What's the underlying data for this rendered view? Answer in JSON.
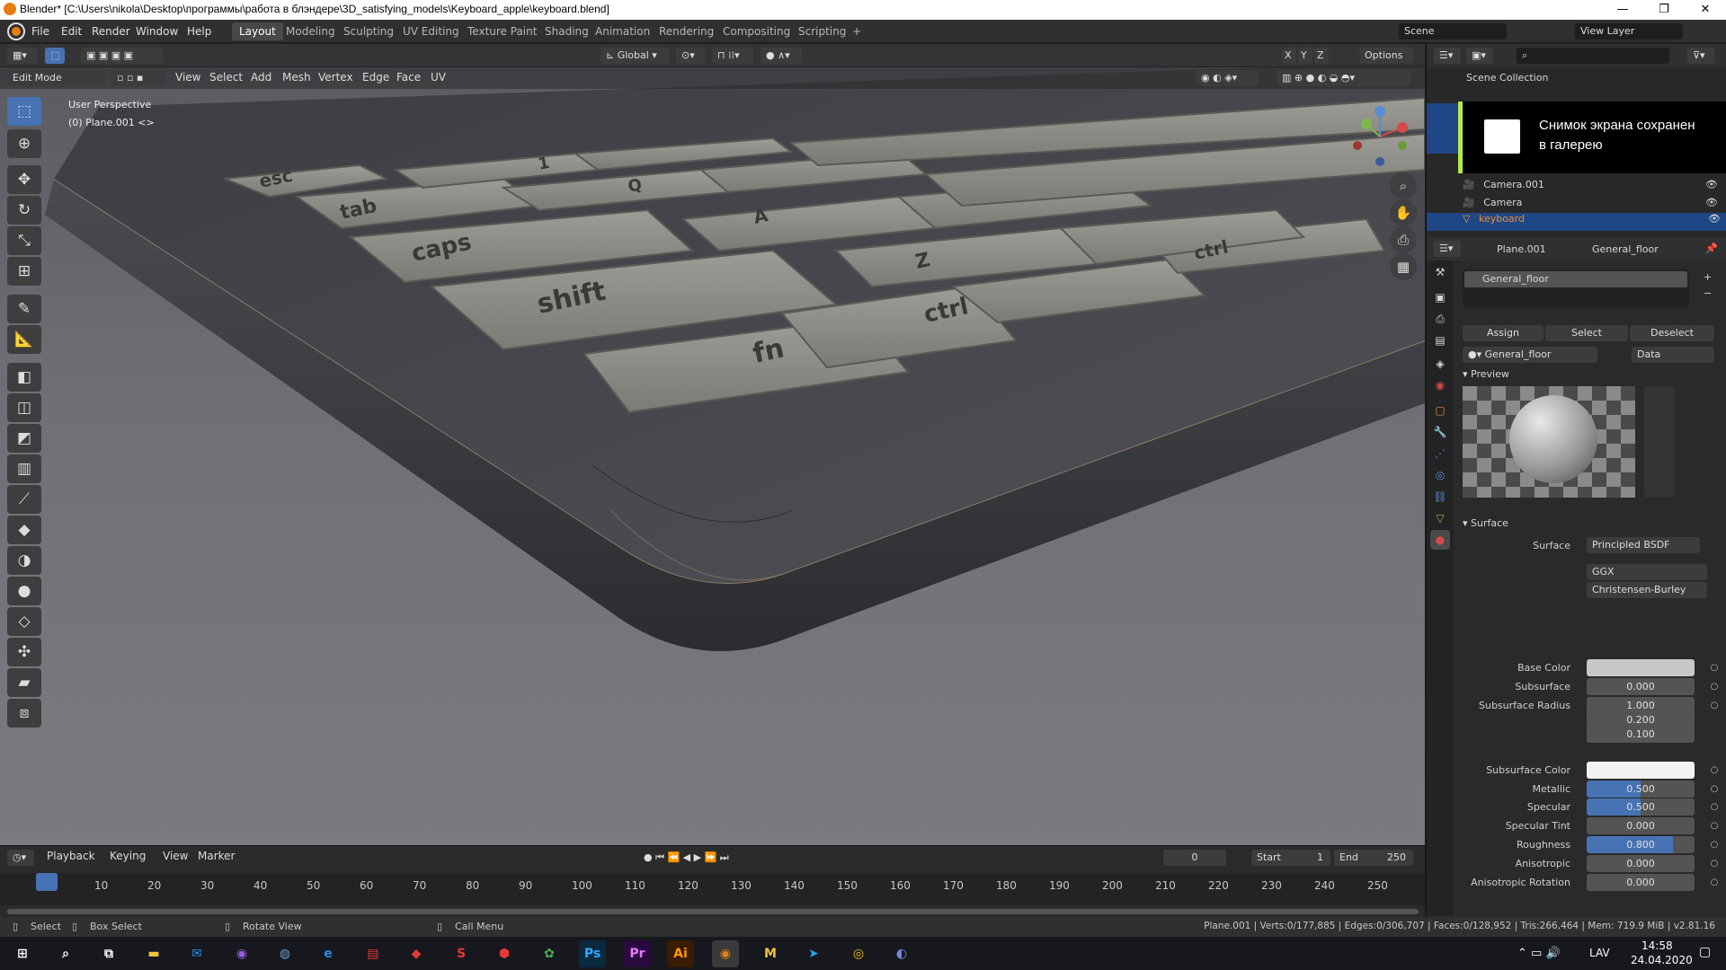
{
  "window": {
    "title": "Blender* [C:\\Users\\nikola\\Desktop\\программы\\работа в блэндере\\3D_satisfying_models\\Keyboard_apple\\keyboard.blend]",
    "minimize": "—",
    "maximize": "❐",
    "close": "✕"
  },
  "menu": [
    "File",
    "Edit",
    "Render",
    "Window",
    "Help"
  ],
  "workspaces": [
    "Layout",
    "Modeling",
    "Sculpting",
    "UV Editing",
    "Texture Paint",
    "Shading",
    "Animation",
    "Rendering",
    "Compositing",
    "Scripting",
    "+"
  ],
  "scene": {
    "name": "Scene",
    "view_layer": "View Layer"
  },
  "viewport_header": {
    "orientation": "Global",
    "options": "Options",
    "axes": [
      "X",
      "Y",
      "Z"
    ]
  },
  "edit_header": {
    "mode": "Edit Mode",
    "items": [
      "View",
      "Select",
      "Add",
      "Mesh",
      "Vertex",
      "Edge",
      "Face",
      "UV"
    ]
  },
  "viewport": {
    "perspective": "User Perspective",
    "object": "(0) Plane.001 <>",
    "keys": [
      "esc",
      "tab",
      "caps",
      "shift",
      "fn",
      "ctrl",
      "ctrl",
      "1",
      "Q",
      "A",
      "Z"
    ]
  },
  "outliner": {
    "title": "Scene Collection",
    "items": [
      "Camera.001",
      "Camera",
      "keyboard"
    ]
  },
  "toast": {
    "line1": "Снимок экрана сохранен",
    "line2": "в галерею"
  },
  "properties": {
    "object": "Plane.001",
    "material": "General_floor",
    "slot": "General_floor",
    "assign": "Assign",
    "select": "Select",
    "deselect": "Deselect",
    "link": "Data",
    "preview_label": "Preview",
    "surface_section": "Surface",
    "surface_label": "Surface",
    "surface_value": "Principled BSDF",
    "distribution": "GGX",
    "subsurface_method": "Christensen-Burley",
    "rows": [
      {
        "label": "Base Color",
        "value": "",
        "type": "color",
        "color": "#c8c8c8"
      },
      {
        "label": "Subsurface",
        "value": "0.000",
        "fill": 0
      },
      {
        "label": "Subsurface Radius",
        "value": "1.000",
        "fill": 0
      },
      {
        "label": "",
        "value": "0.200",
        "fill": 0
      },
      {
        "label": "",
        "value": "0.100",
        "fill": 0
      },
      {
        "label": "Subsurface Color",
        "value": "",
        "type": "color",
        "color": "#f2f2f2"
      },
      {
        "label": "Metallic",
        "value": "0.500",
        "fill": 0.5
      },
      {
        "label": "Specular",
        "value": "0.500",
        "fill": 0.5
      },
      {
        "label": "Specular Tint",
        "value": "0.000",
        "fill": 0
      },
      {
        "label": "Roughness",
        "value": "0.800",
        "fill": 0.8
      },
      {
        "label": "Anisotropic",
        "value": "0.000",
        "fill": 0
      },
      {
        "label": "Anisotropic Rotation",
        "value": "0.000",
        "fill": 0
      }
    ]
  },
  "timeline": {
    "menu": [
      "Playback",
      "Keying",
      "View",
      "Marker"
    ],
    "current_frame": "0",
    "start_label": "Start",
    "start": "1",
    "end_label": "End",
    "end": "250",
    "ticks": [
      "0",
      "10",
      "20",
      "30",
      "40",
      "50",
      "60",
      "70",
      "80",
      "90",
      "100",
      "110",
      "120",
      "130",
      "140",
      "150",
      "160",
      "170",
      "180",
      "190",
      "200",
      "210",
      "220",
      "230",
      "240",
      "250"
    ]
  },
  "status": {
    "select": "Select",
    "box_select": "Box Select",
    "rotate": "Rotate View",
    "call_menu": "Call Menu",
    "stats": "Plane.001 | Verts:0/177,885 | Edges:0/306,707 | Faces:0/128,952 | Tris:266,464 | Mem: 719.9 MiB | v2.81.16"
  },
  "taskbar": {
    "apps": [
      "Ps",
      "Pr",
      "Ai",
      "M"
    ],
    "lang": "LAV",
    "time": "14:58",
    "date": "24.04.2020"
  }
}
